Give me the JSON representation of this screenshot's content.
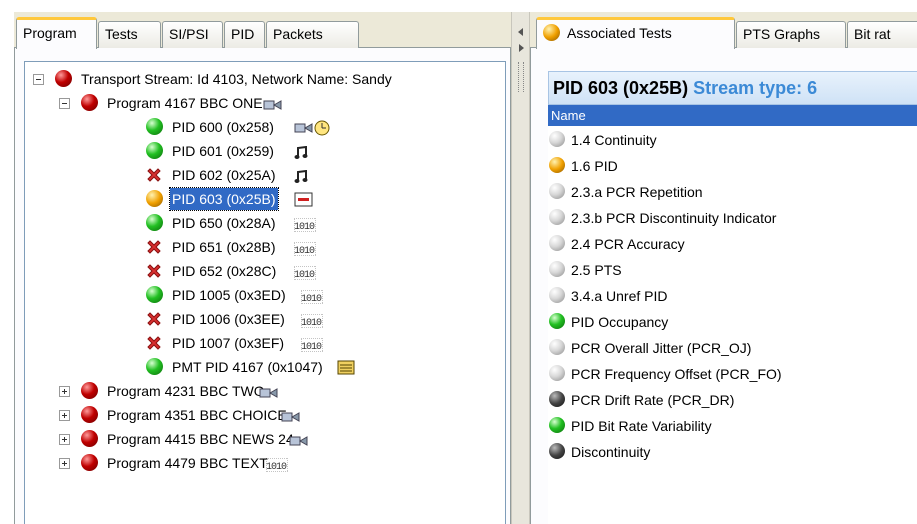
{
  "left_tabs": [
    "Program",
    "Tests",
    "SI/PSI",
    "PID",
    "Packets"
  ],
  "right_tabs": [
    "Associated Tests",
    "PTS Graphs",
    "Bit rat"
  ],
  "tree": {
    "root": {
      "label": "Transport Stream: Id 4103, Network Name: Sandy",
      "status": "red"
    },
    "program_main": {
      "label": "Program 4167 BBC ONE",
      "status": "red"
    },
    "pids": [
      {
        "label": "PID 600 (0x258)",
        "status": "green",
        "icon": "video-clock-icon"
      },
      {
        "label": "PID 601 (0x259)",
        "status": "green",
        "icon": "music-note-icon"
      },
      {
        "label": "PID 602 (0x25A)",
        "status": "error",
        "icon": "music-note-icon"
      },
      {
        "label": "PID 603 (0x25B)",
        "status": "orange",
        "icon": "subtitle-icon",
        "selected": true
      },
      {
        "label": "PID 650 (0x28A)",
        "status": "green",
        "icon": "data-icon"
      },
      {
        "label": "PID 651 (0x28B)",
        "status": "error",
        "icon": "data-icon"
      },
      {
        "label": "PID 652 (0x28C)",
        "status": "error",
        "icon": "data-icon"
      },
      {
        "label": "PID 1005 (0x3ED)",
        "status": "green",
        "icon": "data-icon"
      },
      {
        "label": "PID 1006 (0x3EE)",
        "status": "error",
        "icon": "data-icon"
      },
      {
        "label": "PID 1007 (0x3EF)",
        "status": "error",
        "icon": "data-icon"
      },
      {
        "label": "PMT PID 4167 (0x1047)",
        "status": "green",
        "icon": "table-icon"
      }
    ],
    "programs_collapsed": [
      {
        "label": "Program 4231 BBC TWO",
        "status": "red",
        "icon": "video-icon"
      },
      {
        "label": "Program 4351 BBC CHOICE",
        "status": "red",
        "icon": "video-icon"
      },
      {
        "label": "Program 4415 BBC NEWS 24",
        "status": "red",
        "icon": "video-icon"
      },
      {
        "label": "Program 4479 BBC TEXT",
        "status": "red",
        "icon": "data-icon"
      }
    ]
  },
  "details": {
    "header_pid": "PID 603 (0x25B)",
    "header_stream": "Stream type: 6",
    "list_header": "Name",
    "tests": [
      {
        "label": "1.4 Continuity",
        "status": "gray"
      },
      {
        "label": "1.6 PID",
        "status": "orange"
      },
      {
        "label": "2.3.a PCR Repetition",
        "status": "gray"
      },
      {
        "label": "2.3.b PCR Discontinuity Indicator",
        "status": "gray"
      },
      {
        "label": "2.4 PCR Accuracy",
        "status": "gray"
      },
      {
        "label": "2.5 PTS",
        "status": "gray"
      },
      {
        "label": "3.4.a Unref PID",
        "status": "gray"
      },
      {
        "label": "PID Occupancy",
        "status": "green"
      },
      {
        "label": "PCR Overall Jitter (PCR_OJ)",
        "status": "gray"
      },
      {
        "label": "PCR Frequency Offset (PCR_FO)",
        "status": "gray"
      },
      {
        "label": "PCR Drift Rate (PCR_DR)",
        "status": "dark"
      },
      {
        "label": "PID Bit Rate Variability",
        "status": "green"
      },
      {
        "label": "Discontinuity",
        "status": "dark"
      }
    ]
  }
}
